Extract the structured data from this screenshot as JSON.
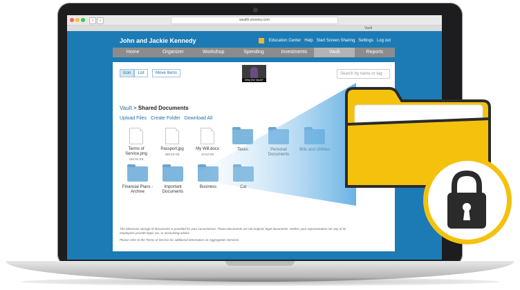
{
  "browser": {
    "url": "wealth.emoney.com",
    "tab_label": "Vault"
  },
  "header": {
    "title": "John and Jackie Kennedy",
    "links": [
      "Education Center",
      "Help",
      "Start Screen Sharing",
      "Settings",
      "Log out"
    ]
  },
  "nav": {
    "items": [
      "Home",
      "Organizer",
      "Workshop",
      "Spending",
      "Investments",
      "Vault",
      "Reports"
    ],
    "active": "Vault"
  },
  "toolbar": {
    "icon_label": "Icon",
    "list_label": "List",
    "move_label": "Move Items",
    "video_caption": "Why the Vault?",
    "search_placeholder": "Search by name or tag"
  },
  "breadcrumb": {
    "root": "Vault",
    "separator": ">",
    "current": "Shared Documents"
  },
  "actions": [
    "Upload Files",
    "Create Folder",
    "Download All"
  ],
  "files": [
    {
      "name": "Terms of Service.png",
      "size": "185.93 KB",
      "kind": "file"
    },
    {
      "name": "Passport.jpg",
      "size": "480.53 KB",
      "kind": "file"
    },
    {
      "name": "My Will.docx",
      "size": "18.53 KB",
      "kind": "file"
    },
    {
      "name": "Taxes",
      "kind": "folder"
    },
    {
      "name": "Personal Documents",
      "kind": "folder"
    },
    {
      "name": "Bills and Utilities",
      "kind": "folder"
    },
    {
      "name": "Financial Plans - Archive",
      "kind": "folder"
    },
    {
      "name": "Important Documents",
      "kind": "folder"
    },
    {
      "name": "Business",
      "kind": "folder"
    },
    {
      "name": "Car",
      "kind": "folder"
    }
  ],
  "disclaimer": "The electronic storage of documents is provided for your convenience. These documents are not original, legal documents. Neither your representative nor any of its employees provide legal, tax, or accounting advice.",
  "disclaimer2": "Please refer to the Terms of Service for additional information on Aggregation Services.",
  "colors": {
    "accent": "#1c7bb5",
    "folder": "#f4c20d",
    "lock": "#2b2b2b"
  }
}
